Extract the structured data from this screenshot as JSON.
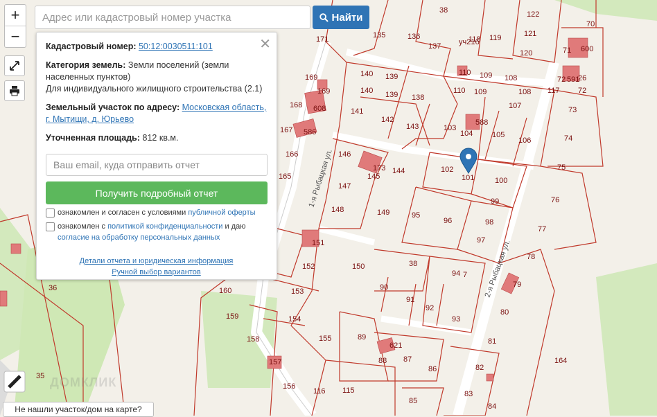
{
  "search": {
    "placeholder": "Адрес или кадастровый номер участка",
    "button_label": "Найти"
  },
  "zoom": {
    "in": "+",
    "out": "−"
  },
  "panel": {
    "cadastral_label": "Кадастровый номер:",
    "cadastral_value": "50:12:0030511:101",
    "category_label": "Категория земель:",
    "category_value": "Земли поселений (земли населенных пунктов)",
    "category_use": "Для индивидуального жилищного строительства (2.1)",
    "address_label": "Земельный участок по адресу:",
    "address_value": "Московская область, г. Мытищи, д. Юрьево",
    "area_label": "Уточненная площадь:",
    "area_value": "812 кв.м.",
    "email_placeholder": "Ваш email, куда отправить отчет",
    "report_button": "Получить подробный отчет",
    "consent1_text": "ознакомлен и согласен с условиями",
    "consent1_link": "публичной оферты",
    "consent2_text_a": "ознакомлен с",
    "consent2_link_a": "политикой конфиденциальности",
    "consent2_text_b": "и даю",
    "consent2_link_b": "согласие на обработку персональных данных",
    "details_link": "Детали отчета и юридическая информация",
    "manual_link": "Ручной выбор вариантов"
  },
  "bottom_prompt": "Не нашли участок/дом на карте?",
  "watermark": "ДОМКЛИК",
  "map": {
    "streets": [
      "1-я Рыбацкая ул.",
      "2-я Рыбацкая ул."
    ],
    "plots": [
      "38",
      "122",
      "70",
      "135",
      "136",
      "137",
      "118",
      "119",
      "121",
      "уч21б",
      "71",
      "600",
      "120",
      "110",
      "169",
      "171",
      "140",
      "139",
      "109",
      "108",
      "591",
      "72",
      "26",
      "82",
      "117",
      "168",
      "608",
      "138",
      "141",
      "142",
      "143",
      "107",
      "73",
      "167",
      "586",
      "103",
      "104",
      "588",
      "105",
      "106",
      "74",
      "166",
      "146",
      "145",
      "43",
      "144",
      "102",
      "101",
      "100",
      "75",
      "165",
      "147",
      "149",
      "99",
      "76",
      "148",
      "95",
      "96",
      "98",
      "77",
      "151",
      "97",
      "78",
      "152",
      "150",
      "94",
      "79",
      "36",
      "153",
      "90",
      "91",
      "92",
      "93",
      "160",
      "80",
      "159",
      "154",
      "155",
      "89",
      "621",
      "81",
      "158",
      "88",
      "87",
      "86",
      "164",
      "157",
      "156",
      "82",
      "116",
      "115",
      "85",
      "83",
      "35",
      "84",
      "7"
    ]
  },
  "colors": {
    "accent": "#2f74b5",
    "report_button": "#5cb85c",
    "parcel_line": "#c0392b",
    "building": "#e07a7a",
    "green": "#cfe8b5",
    "road": "#ffffff"
  }
}
